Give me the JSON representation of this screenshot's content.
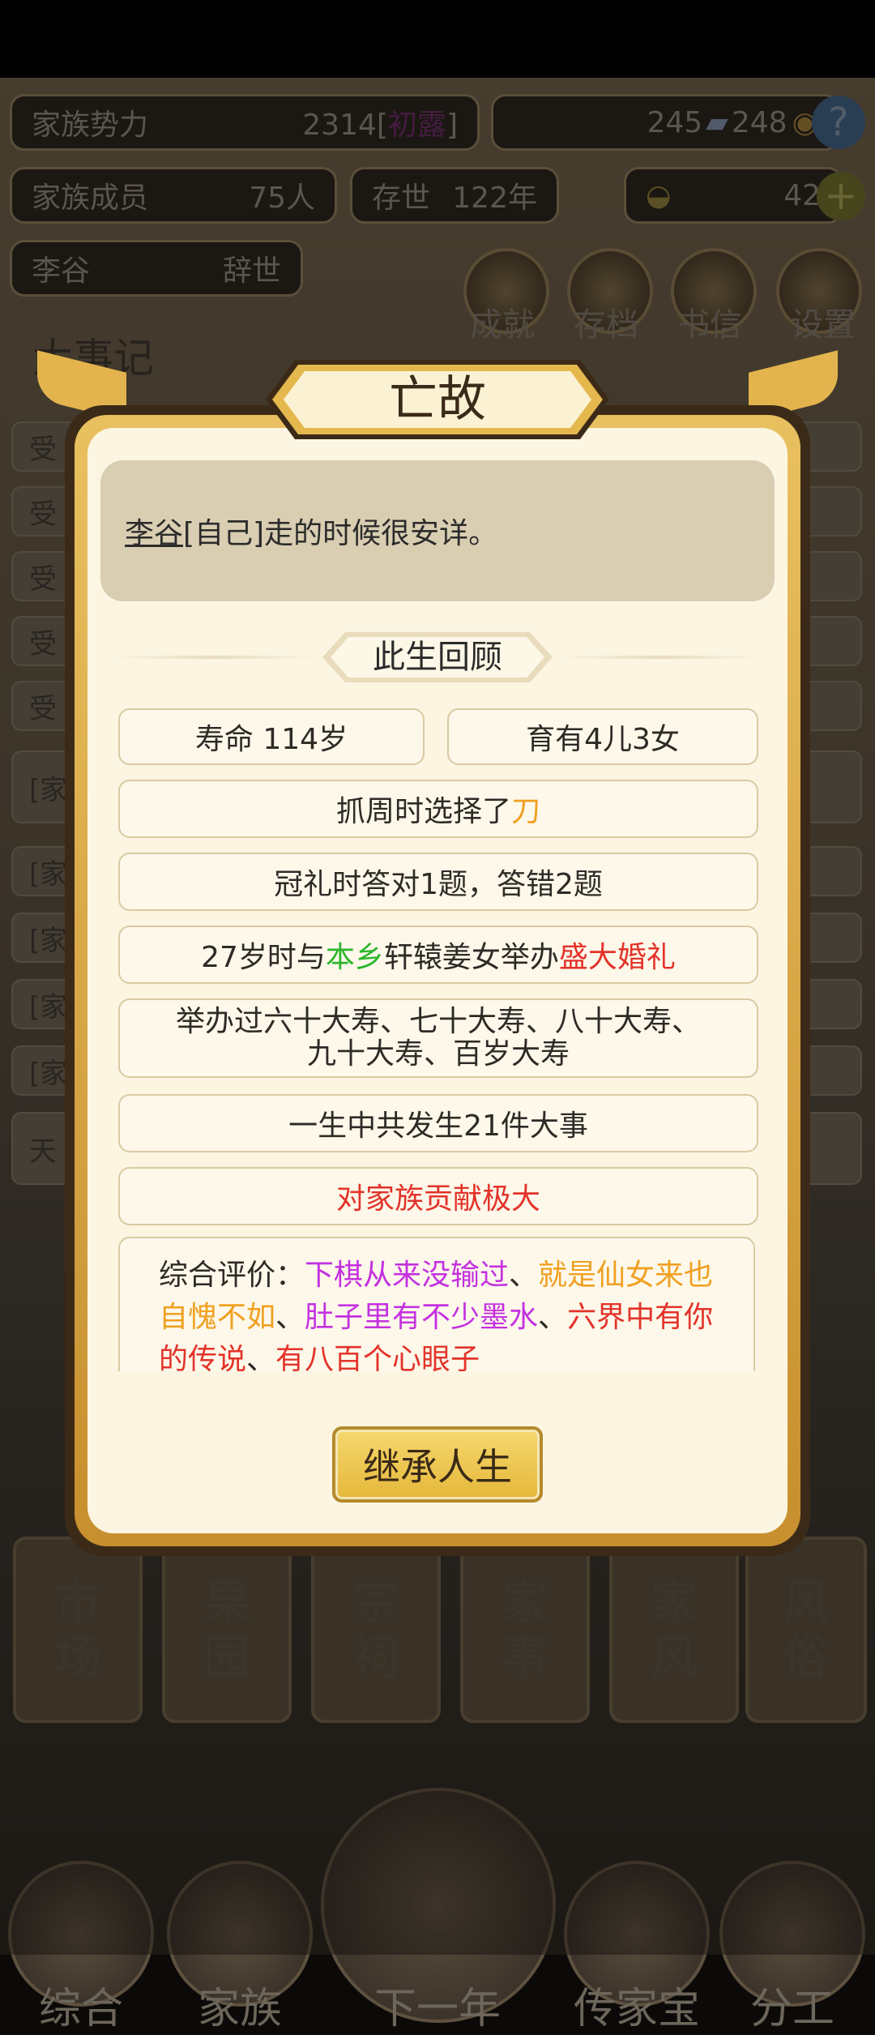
{
  "hud": {
    "clan_power_label": "家族势力",
    "clan_power_value": "2314",
    "clan_power_bracket_open": "[",
    "clan_power_rank": "初露",
    "clan_power_bracket_close": "]",
    "silver": "245",
    "copper": "248",
    "members_label": "家族成员",
    "members_value": "75人",
    "existed_label": "存世",
    "existed_value": "122年",
    "gold": "42",
    "person_name": "李谷",
    "person_status": "辞世"
  },
  "top_buttons": [
    "成就",
    "存档",
    "书信",
    "设置"
  ],
  "chronicle_title": "大事记",
  "chronicle_rows": [
    "受",
    "受",
    "受",
    "受",
    "受",
    "[家",
    "[家",
    "[家",
    "[家",
    "[家",
    "天"
  ],
  "bottom_tiles": [
    [
      "市",
      "场"
    ],
    [
      "果",
      "园"
    ],
    [
      "宗",
      "祠"
    ],
    [
      "家",
      "事"
    ],
    [
      "家",
      "风"
    ],
    [
      "风",
      "俗"
    ]
  ],
  "nav": [
    "综合",
    "家族",
    "下一年",
    "传家宝",
    "分工"
  ],
  "dialog": {
    "title": "亡故",
    "message_name": "李谷",
    "message_rest": "[自己]走的时候很安详。",
    "section_title": "此生回顾",
    "lifespan": "寿命 114岁",
    "children": "育有4儿3女",
    "zhuazhou_prefix": "抓周时选择了",
    "zhuazhou_item": "刀",
    "crowning": "冠礼时答对1题，答错2题",
    "marriage_prefix": "27岁时与",
    "marriage_place": "本乡",
    "marriage_mid": "轩辕姜女举办",
    "marriage_type": "盛大婚礼",
    "birthdays_line1": "举办过六十大寿、七十大寿、八十大寿、",
    "birthdays_line2": "九十大寿、百岁大寿",
    "events": "一生中共发生21件大事",
    "contribution": "对家族贡献极大",
    "eval_label": "综合评价：",
    "eval_items": [
      {
        "text": "下棋从来没输过",
        "color": "#c431e0"
      },
      {
        "text": "、",
        "color": "#2e2a26"
      },
      {
        "text": "就是仙女来也自愧不如",
        "color": "#f0a020"
      },
      {
        "text": "、",
        "color": "#2e2a26"
      },
      {
        "text": "肚子里有不少墨水",
        "color": "#c431e0"
      },
      {
        "text": "、",
        "color": "#2e2a26"
      },
      {
        "text": "六界中有你的传说",
        "color": "#e3332a"
      },
      {
        "text": "、",
        "color": "#2e2a26"
      },
      {
        "text": "有八百个心眼子",
        "color": "#e3332a"
      }
    ],
    "inherit_button": "继承人生"
  }
}
